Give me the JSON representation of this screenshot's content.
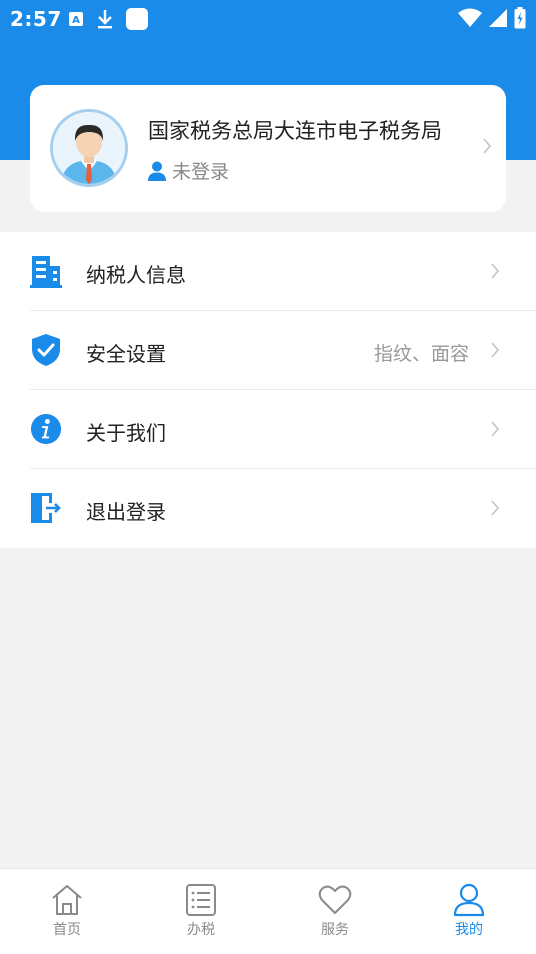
{
  "status_bar": {
    "time": "2:57",
    "left_icons": [
      "keyboard-a-icon",
      "download-icon",
      "app-square-icon"
    ],
    "right_icons": [
      "wifi-icon",
      "signal-icon",
      "battery-icon"
    ]
  },
  "profile": {
    "org_name": "国家税务总局大连市电子税务局",
    "login_status": "未登录"
  },
  "menu": {
    "items": [
      {
        "label": "纳税人信息",
        "value": "",
        "icon": "building-icon"
      },
      {
        "label": "安全设置",
        "value": "指纹、面容",
        "icon": "shield-check-icon"
      },
      {
        "label": "关于我们",
        "value": "",
        "icon": "info-icon"
      },
      {
        "label": "退出登录",
        "value": "",
        "icon": "logout-icon"
      }
    ]
  },
  "bottom_nav": {
    "items": [
      {
        "label": "首页",
        "icon": "home-icon"
      },
      {
        "label": "办税",
        "icon": "list-icon"
      },
      {
        "label": "服务",
        "icon": "heart-icon"
      },
      {
        "label": "我的",
        "icon": "user-icon"
      }
    ],
    "active_index": 3
  },
  "colors": {
    "primary": "#1a8be8",
    "background": "#f2f2f2",
    "text": "#222222",
    "muted": "#999999"
  }
}
